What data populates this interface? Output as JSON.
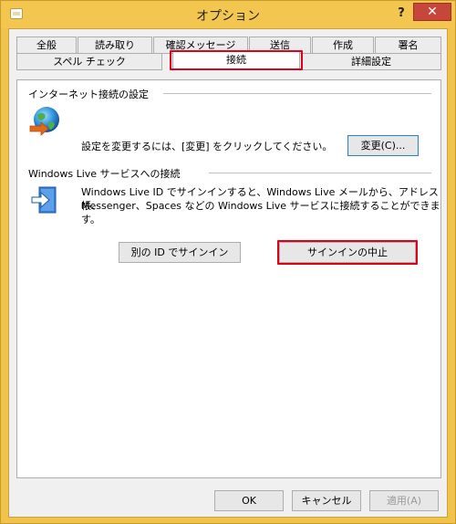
{
  "window": {
    "title": "オプション",
    "help_label": "?",
    "close_label": "✕"
  },
  "tabs": {
    "row1": [
      "全般",
      "読み取り",
      "確認メッセージ",
      "送信",
      "作成",
      "署名"
    ],
    "row2": [
      "スペル チェック",
      "接続",
      "詳細設定"
    ],
    "selected": "接続"
  },
  "internet": {
    "heading": "インターネット接続の設定",
    "instruction": "設定を変更するには、[変更] をクリックしてください。",
    "change_button": "変更(C)..."
  },
  "live": {
    "heading": "Windows Live サービスへの接続",
    "description_line1": "Windows Live ID でサインインすると、Windows Live メールから、アドレス帳、",
    "description_line2": "Messenger、Spaces などの Windows Live サービスに接続することができます。",
    "signin_other_button": "別の ID でサインイン",
    "stop_signin_button": "サインインの中止"
  },
  "footer": {
    "ok": "OK",
    "cancel": "キャンセル",
    "apply": "適用(A)"
  },
  "colors": {
    "title_bar": "#f3c64f",
    "close_button": "#c7463b",
    "highlight_box": "#e0001a"
  }
}
